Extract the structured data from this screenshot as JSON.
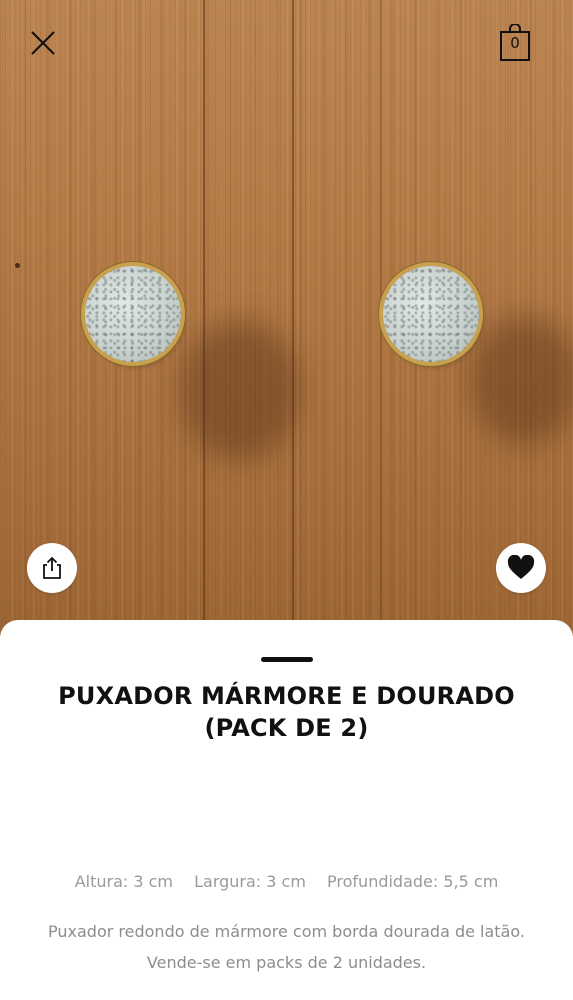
{
  "header": {
    "close_icon": "close-icon",
    "bag_icon": "shopping-bag-icon",
    "bag_count": "0"
  },
  "image_actions": {
    "share_icon": "share-icon",
    "like_icon": "heart-icon"
  },
  "product": {
    "title_line1": "PUXADOR MÁRMORE E DOURADO",
    "title_line2": "(PACK DE 2)",
    "dimensions": {
      "height": "Altura: 3 cm",
      "width": "Largura: 3 cm",
      "depth": "Profundidade: 5,5 cm"
    },
    "description_line1": "Puxador redondo de mármore com borda dourada de latão.",
    "description_line2": "Vende-se em packs de 2 unidades."
  },
  "colors": {
    "text_primary": "#111111",
    "text_muted": "#9a9a9a",
    "sheet_bg": "#ffffff"
  }
}
